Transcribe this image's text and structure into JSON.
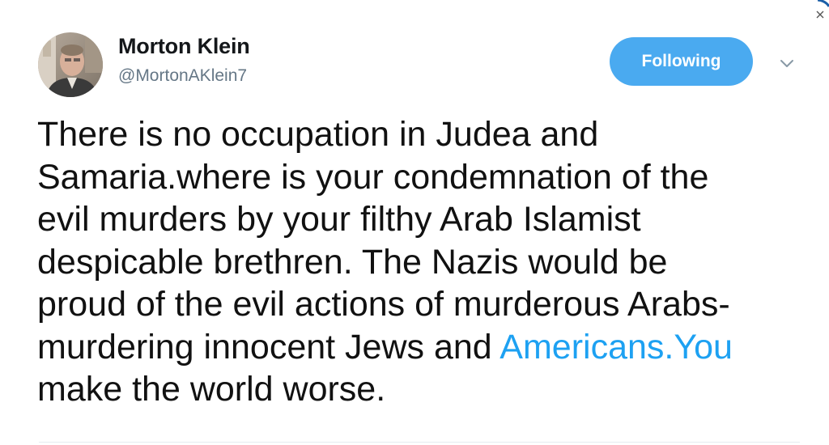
{
  "author": {
    "display_name": "Morton Klein",
    "handle": "@MortonAKlein7"
  },
  "follow_button": {
    "label": "Following"
  },
  "tweet": {
    "lines": [
      "There is no occupation in Judea and",
      "Samaria.where is your condemnation of the",
      "evil murders by your filthy Arab Islamist",
      "despicable brethren. The Nazis would be",
      "proud of the evil actions of murderous Arabs-"
    ],
    "line6_text": "murdering innocent Jews and ",
    "line6_link": "Americans.You",
    "line7": "make the world worse."
  },
  "icons": {
    "caret": "chevron-down-icon",
    "close": "close-icon"
  },
  "colors": {
    "accent": "#1da1f2",
    "button_bg": "#4aaaf0",
    "secondary_text": "#657786"
  }
}
